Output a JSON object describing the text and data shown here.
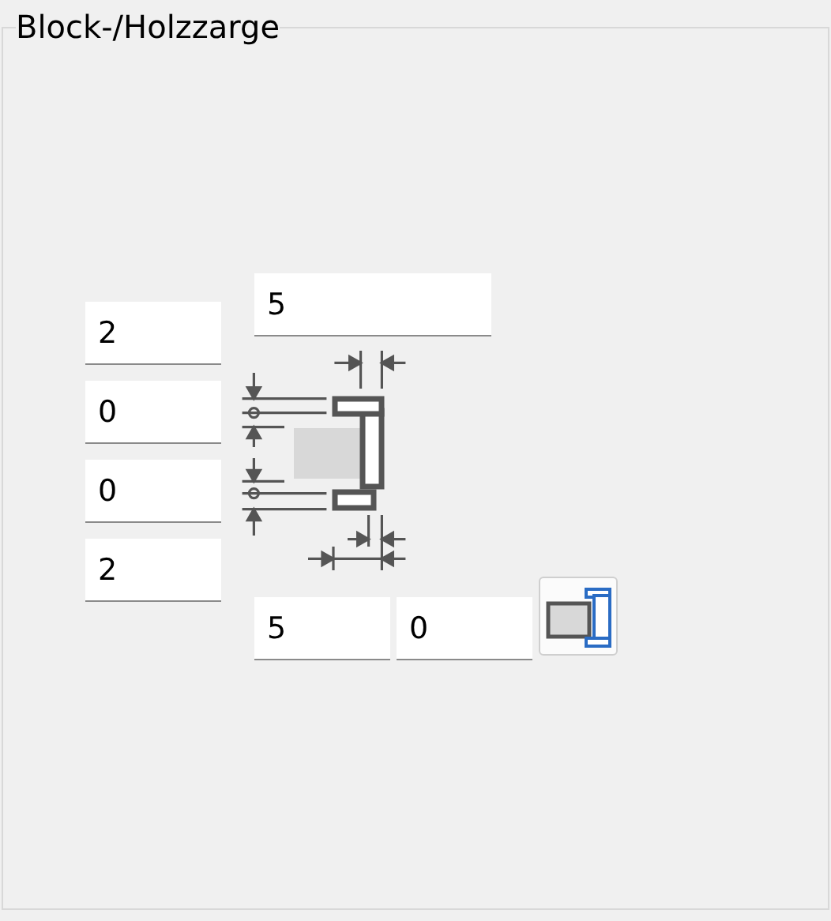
{
  "group": {
    "title": "Block-/Holzzarge"
  },
  "left_fields": [
    "2",
    "0",
    "0",
    "2"
  ],
  "top_field": "5",
  "bottom_fields": [
    "5",
    "0"
  ]
}
